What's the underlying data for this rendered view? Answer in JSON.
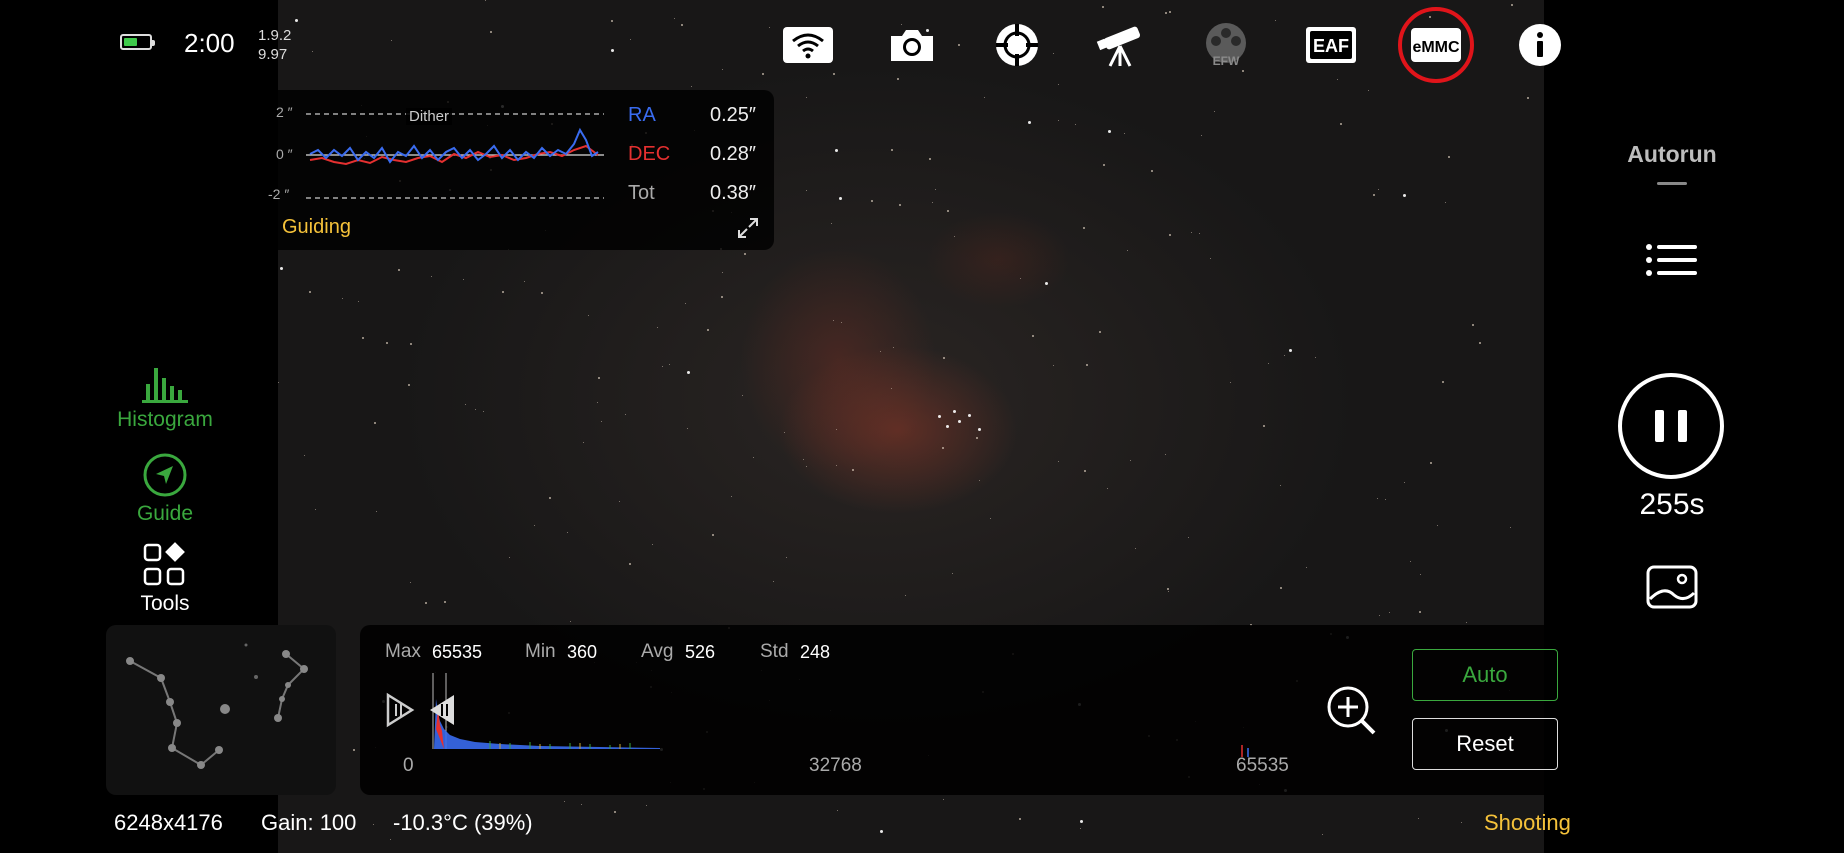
{
  "status": {
    "time": "2:00",
    "version_line1": "1.9.2",
    "version_line2": "9.97",
    "battery_level": 0.55,
    "battery_color": "#3ec94a"
  },
  "toolbar": {
    "icons": [
      "wifi-icon",
      "camera-icon",
      "crosshair-icon",
      "telescope-icon",
      "efw-icon",
      "eaf-icon",
      "emmc-icon",
      "info-icon"
    ],
    "efw_label": "EFW",
    "eaf_label": "EAF",
    "emmc_label": "eMMC",
    "highlight_color": "#e0141a"
  },
  "guiding": {
    "title": "Guiding",
    "dither_label": "Dither",
    "axis_top": "2 ″",
    "axis_mid": "0 ″",
    "axis_bottom": "-2 ″",
    "rows": [
      {
        "label": "RA",
        "value": "0.25″",
        "color": "#3a6cf0"
      },
      {
        "label": "DEC",
        "value": "0.28″",
        "color": "#e53030"
      },
      {
        "label": "Tot",
        "value": "0.38″",
        "color": "#aaaaaa"
      }
    ]
  },
  "left_tools": {
    "histogram": "Histogram",
    "guide": "Guide",
    "tools": "Tools"
  },
  "right_panel": {
    "autorun": "Autorun",
    "remaining": "255s",
    "progress": 0.2
  },
  "histogram": {
    "max_label": "Max",
    "max_value": "65535",
    "min_label": "Min",
    "min_value": "360",
    "avg_label": "Avg",
    "avg_value": "526",
    "std_label": "Std",
    "std_value": "248",
    "axis_start": "0",
    "axis_mid": "32768",
    "axis_end": "65535",
    "auto_label": "Auto",
    "reset_label": "Reset"
  },
  "footer": {
    "resolution": "6248x4176",
    "gain": "Gain: 100",
    "temperature": "-10.3°C (39%)",
    "state": "Shooting"
  },
  "colors": {
    "accent_green": "#3aa83e",
    "accent_yellow": "#f5c23a"
  }
}
